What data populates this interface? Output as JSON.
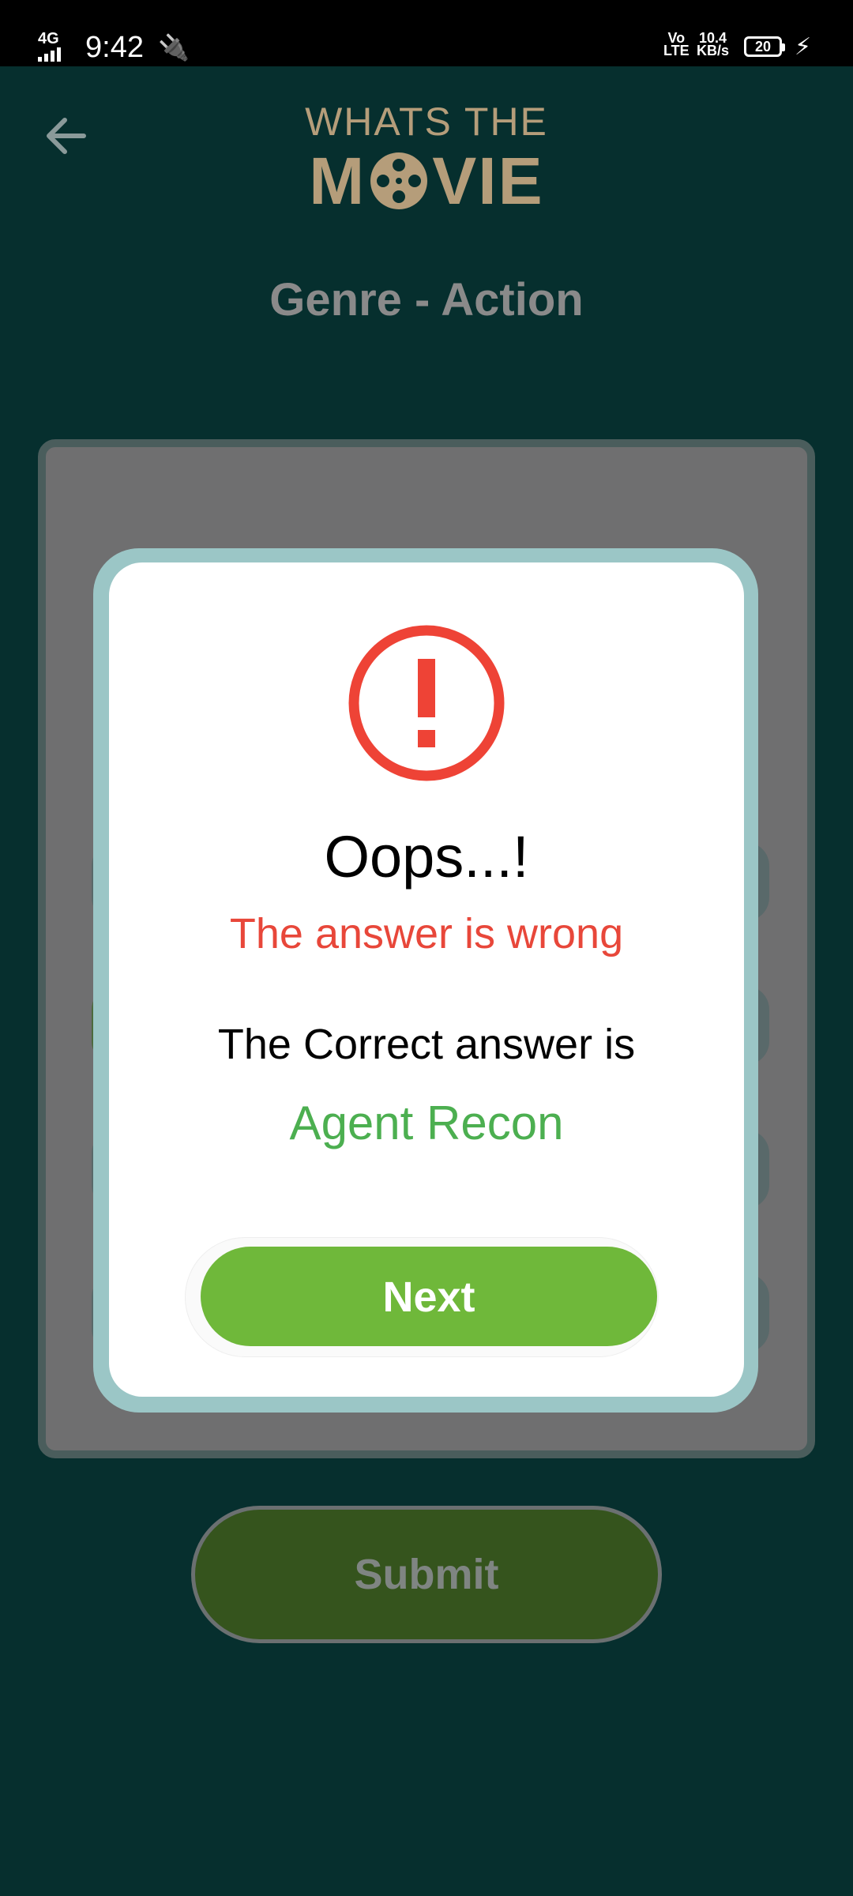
{
  "status_bar": {
    "network": "4G",
    "time": "9:42",
    "volte_top": "Vo",
    "volte_bottom": "LTE",
    "speed_value": "10.4",
    "speed_unit": "KB/s",
    "battery": "20"
  },
  "header": {
    "logo_top": "WHATS THE",
    "logo_m": "M",
    "logo_rest": "VIE"
  },
  "genre_title": "Genre - Action",
  "submit_label": "Submit",
  "dialog": {
    "title": "Oops...!",
    "subtitle": "The answer is wrong",
    "correct_label": "The Correct answer is",
    "correct_answer": "Agent Recon",
    "next_label": "Next"
  },
  "colors": {
    "background": "#062f2e",
    "logo": "#b59d7a",
    "error": "#e8473a",
    "success": "#4caf50",
    "next_button": "#6fb83a",
    "modal_border": "#9bc6c6"
  },
  "icons": {
    "back": "arrow-left-icon",
    "alert": "exclamation-circle-icon",
    "logo_reel": "film-reel-icon",
    "usb": "usb-icon",
    "charging": "lightning-bolt-icon"
  }
}
